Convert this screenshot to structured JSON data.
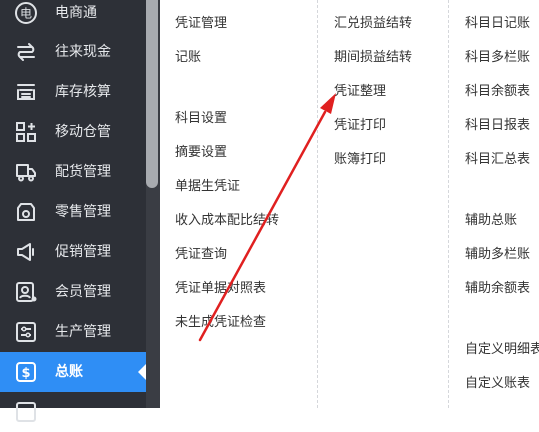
{
  "sidebar": {
    "items": [
      {
        "label": "电商通",
        "icon": "ecommerce-icon"
      },
      {
        "label": "往来现金",
        "icon": "transfer-icon"
      },
      {
        "label": "库存核算",
        "icon": "inventory-icon"
      },
      {
        "label": "移动仓管",
        "icon": "mobile-warehouse-icon"
      },
      {
        "label": "配货管理",
        "icon": "delivery-truck-icon"
      },
      {
        "label": "零售管理",
        "icon": "retail-icon"
      },
      {
        "label": "促销管理",
        "icon": "megaphone-icon"
      },
      {
        "label": "会员管理",
        "icon": "member-icon"
      },
      {
        "label": "生产管理",
        "icon": "production-icon"
      },
      {
        "label": "总账",
        "icon": "ledger-icon",
        "active": true
      }
    ],
    "active_color": "#2f8ef5",
    "background": "#2d3037"
  },
  "menu": {
    "col1": [
      "凭证管理",
      "记账",
      "科目设置",
      "摘要设置",
      "单据生凭证",
      "收入成本配比结转",
      "凭证查询",
      "凭证单据对照表",
      "未生成凭证检查"
    ],
    "col2": [
      "汇兑损益结转",
      "期间损益结转",
      "凭证整理",
      "凭证打印",
      "账簿打印"
    ],
    "col3": [
      "科目日记账",
      "科目多栏账",
      "科目余额表",
      "科目日报表",
      "科目汇总表",
      "辅助总账",
      "辅助多栏账",
      "辅助余额表",
      "自定义明细表",
      "自定义账表"
    ]
  },
  "annotation": {
    "type": "arrow",
    "color": "#e02020",
    "points_to": "凭证整理"
  }
}
